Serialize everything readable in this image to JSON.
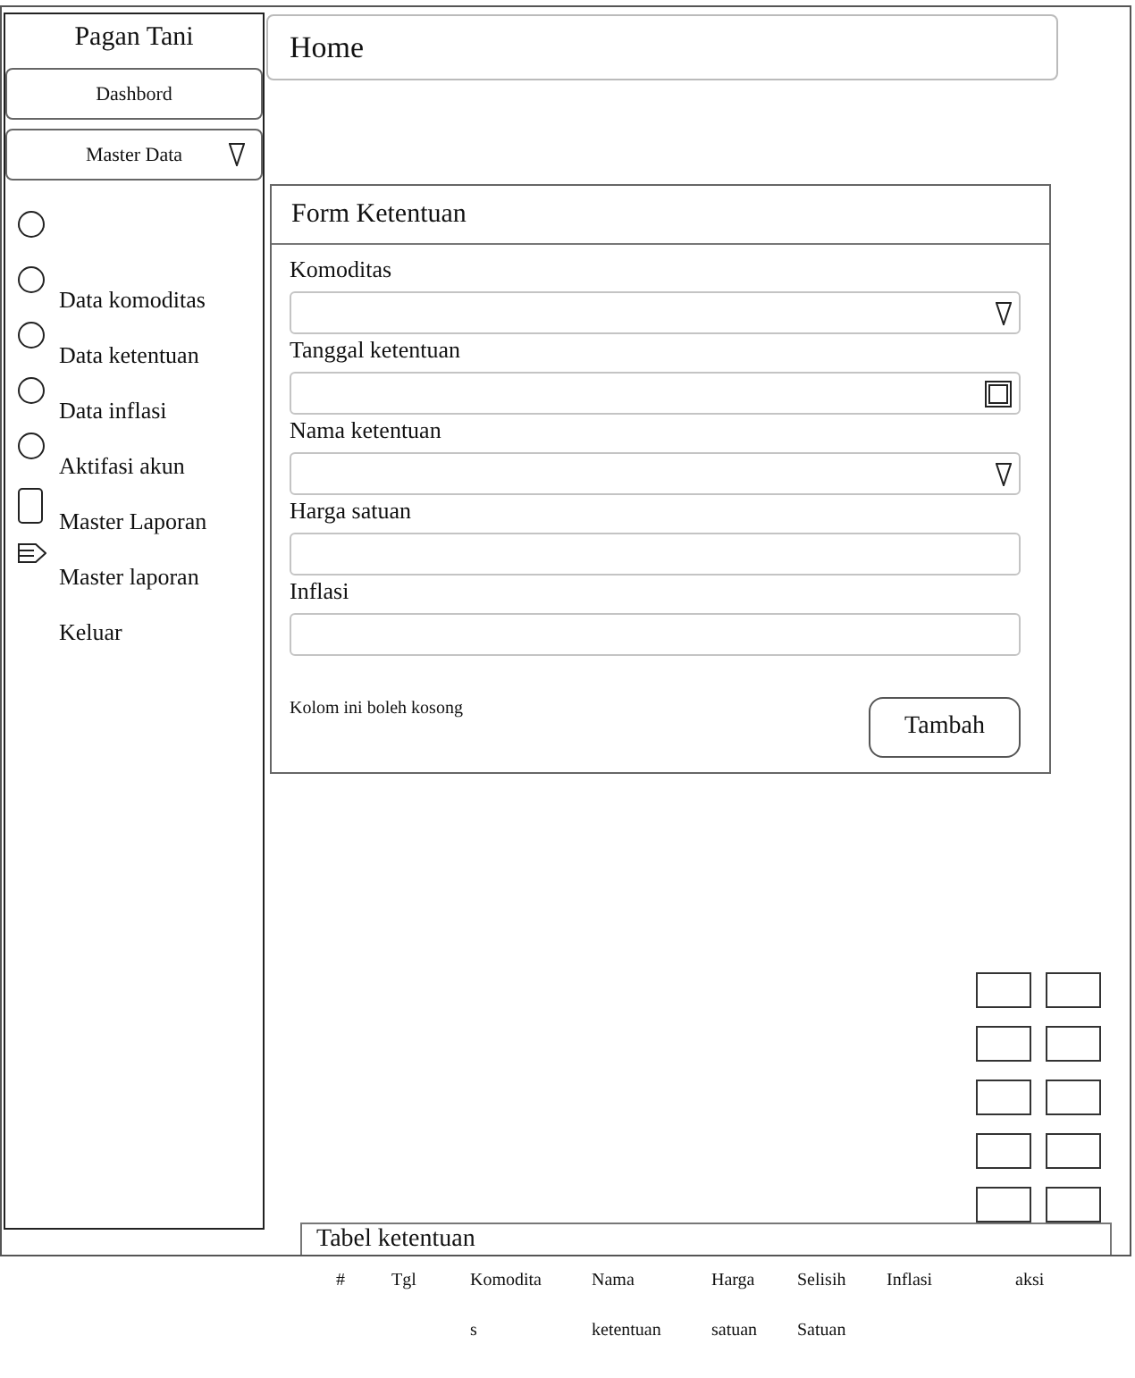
{
  "sidebar": {
    "title": "Pagan Tani",
    "nav": [
      {
        "label": "Dashbord",
        "kind": "plain"
      },
      {
        "label": "Master Data",
        "kind": "dropdown"
      }
    ],
    "items": [
      {
        "kind": "circle"
      },
      {
        "label": "Data komoditas",
        "kind": "circle"
      },
      {
        "label": "Data ketentuan",
        "kind": "circle"
      },
      {
        "label": "Data inflasi",
        "kind": "circle"
      },
      {
        "label": "Aktifasi akun",
        "kind": "circle"
      },
      {
        "label": "Master Laporan",
        "kind": "page"
      },
      {
        "label": "Master laporan",
        "kind": "arrow"
      },
      {
        "label": "Keluar",
        "kind": "plain"
      }
    ]
  },
  "header": {
    "title": "Home"
  },
  "form": {
    "title": "Form Ketentuan",
    "fields": [
      {
        "label": "Komoditas",
        "kind": "select"
      },
      {
        "label": "Tanggal ketentuan",
        "kind": "date"
      },
      {
        "label": "Nama ketentuan",
        "kind": "select"
      },
      {
        "label": "Harga satuan",
        "kind": "text"
      },
      {
        "label": "Inflasi",
        "kind": "text"
      }
    ],
    "note": "Kolom ini boleh kosong",
    "submit": "Tambah"
  },
  "table": {
    "title": "Tabel ketentuan",
    "columns": [
      "#",
      "Tgl",
      "Komoditas",
      "Nama ketentuan",
      "Harga satuan",
      "Selisih Satuan",
      "Inflasi",
      "aksi"
    ]
  }
}
